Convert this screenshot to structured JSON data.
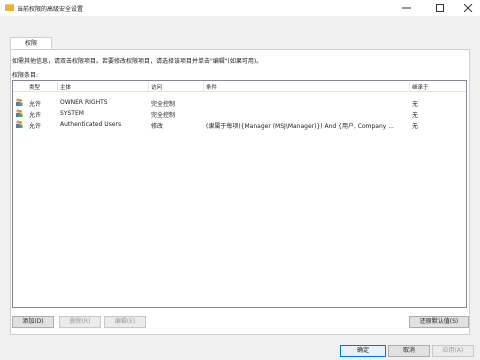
{
  "window": {
    "title": "当前权限的高级安全设置"
  },
  "tabs": [
    {
      "label": "权限"
    }
  ],
  "info_text": "如需其他信息，请双击权限项目。若要修改权限项目，请选择该项目并单击\"编辑\"(如果可用)。",
  "list_label": "权限条目:",
  "columns": {
    "type": "类型",
    "principal": "主体",
    "access": "访问",
    "condition": "条件",
    "inherited_from": "继承于"
  },
  "entries": [
    {
      "type": "允许",
      "principal": "OWNER RIGHTS",
      "access": "完全控制",
      "condition": "",
      "inherited_from": "无",
      "icon": "users-icon"
    },
    {
      "type": "允许",
      "principal": "SYSTEM",
      "access": "完全控制",
      "condition": "",
      "inherited_from": "无",
      "icon": "users-icon"
    },
    {
      "type": "允许",
      "principal": "Authenticated Users",
      "access": "修改",
      "condition": "(隶属于每项({Manager (MSJ\\Manager)}) And {用户, Company ...",
      "inherited_from": "无",
      "icon": "users-icon"
    }
  ],
  "buttons": {
    "add": "添加(D)",
    "remove": "删除(R)",
    "edit": "编辑(E)",
    "restore_defaults": "还原默认值(S)",
    "ok": "确定",
    "cancel": "取消",
    "apply": "应用(A)"
  },
  "colors": {
    "accent": "#0078d7",
    "folder": "#e8b33a"
  }
}
